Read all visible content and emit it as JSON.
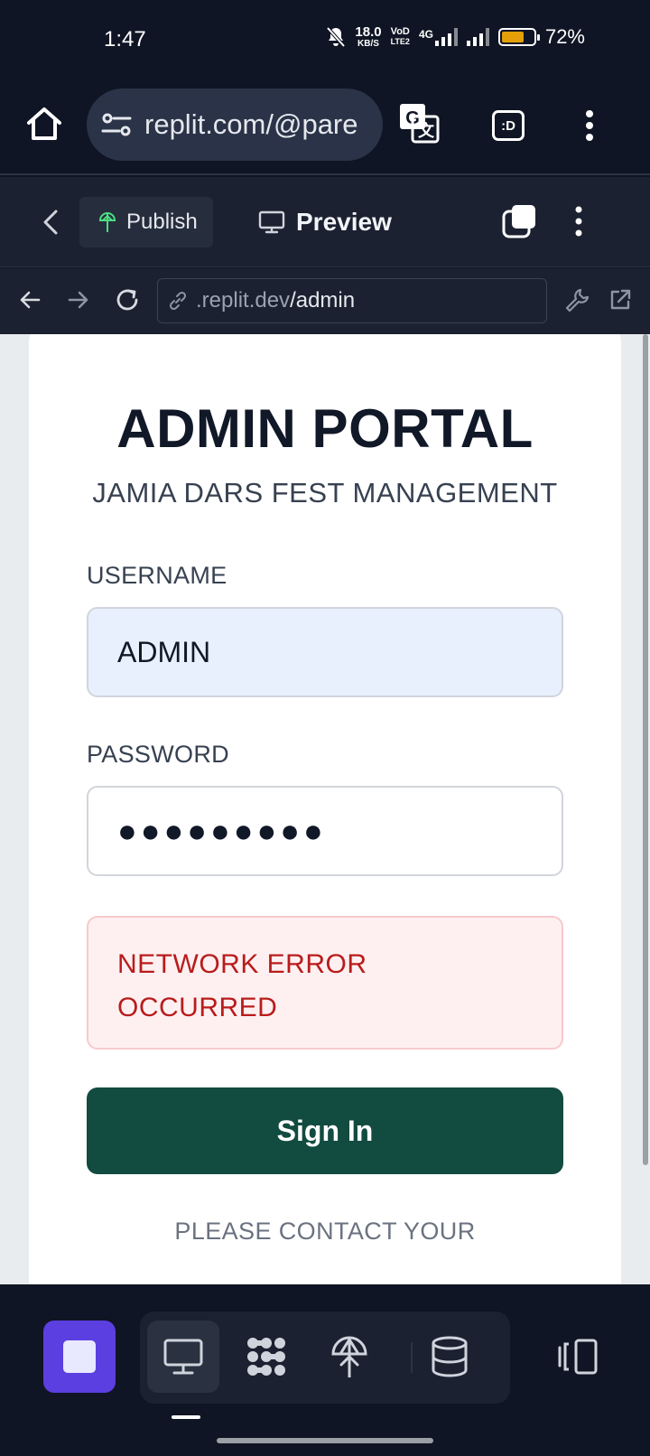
{
  "status_bar": {
    "time": "1:47",
    "net_speed": "18.0",
    "net_unit": "KB/S",
    "volte_top": "VoD",
    "volte_bottom": "LTE2",
    "network": "4G",
    "battery_percent": "72%",
    "battery_level": 0.72
  },
  "browser": {
    "url": "replit.com/@pare",
    "translate_icon": "translate-icon",
    "extension_label": ":D"
  },
  "replit_toolbar": {
    "publish_label": "Publish",
    "preview_label": "Preview"
  },
  "address": {
    "domain": ".replit.dev",
    "path": "/admin"
  },
  "login": {
    "title": "ADMIN PORTAL",
    "subtitle": "JAMIA DARS FEST MANAGEMENT",
    "username_label": "USERNAME",
    "username_value": "ADMIN",
    "password_label": "PASSWORD",
    "password_value": "●●●●●●●●●",
    "error_line1": "NETWORK ERROR",
    "error_line2": "OCCURRED",
    "signin_label": "Sign In",
    "contact_text": "PLEASE CONTACT YOUR"
  },
  "colors": {
    "accent_primary": "#124b40",
    "error_text": "#b91c1c",
    "stop_button": "#5b3fe0",
    "battery_fill": "#e3a008"
  }
}
